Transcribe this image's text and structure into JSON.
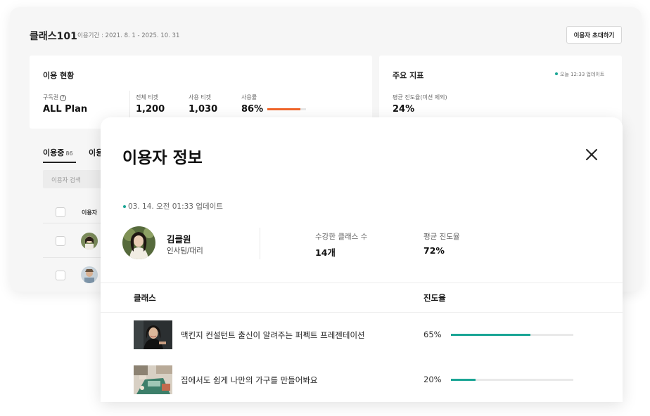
{
  "dashboard": {
    "title": "클래스101",
    "period": "이용기간 : 2021. 8. 1 - 2025. 10. 31",
    "invite_button": "이용자 초대하기",
    "usage_card": {
      "title": "이용 현황",
      "plan_label": "구독권",
      "plan_value": "ALL Plan",
      "total_label": "전체 티켓",
      "total_value": "1,200",
      "used_label": "사용 티켓",
      "used_value": "1,030",
      "rate_label": "사용률",
      "rate_value": "86%",
      "rate_fraction": 0.86
    },
    "metric_card": {
      "title": "주요 지표",
      "updated": "오늘 12:33 업데이트",
      "avg_label": "평균 진도율(미션 제외)",
      "avg_value": "24%"
    },
    "tabs": [
      {
        "label": "이용중",
        "count": "86"
      },
      {
        "label": "이용"
      }
    ],
    "search_placeholder": "이용자 검색",
    "column_user": "이용자"
  },
  "modal": {
    "title": "이용자 정보",
    "updated": "03. 14. 오전 01:33 업데이트",
    "user": {
      "name": "김클원",
      "dept": "인사팀/대리"
    },
    "stats": {
      "classes_label": "수강한 클래스 수",
      "classes_value": "14개",
      "progress_label": "평균 진도율",
      "progress_value": "72%"
    },
    "table": {
      "col_class": "클래스",
      "col_progress": "진도율",
      "rows": [
        {
          "title": "맥킨지 컨설턴트 출신이 알려주는 퍼펙트 프레젠테이션",
          "percent": "65%",
          "fraction": 0.65
        },
        {
          "title": "집에서도 쉽게 나만의 가구를 만들어봐요",
          "percent": "20%",
          "fraction": 0.2
        }
      ]
    }
  },
  "colors": {
    "accent_orange": "#f0652a",
    "accent_teal": "#1aa595"
  }
}
